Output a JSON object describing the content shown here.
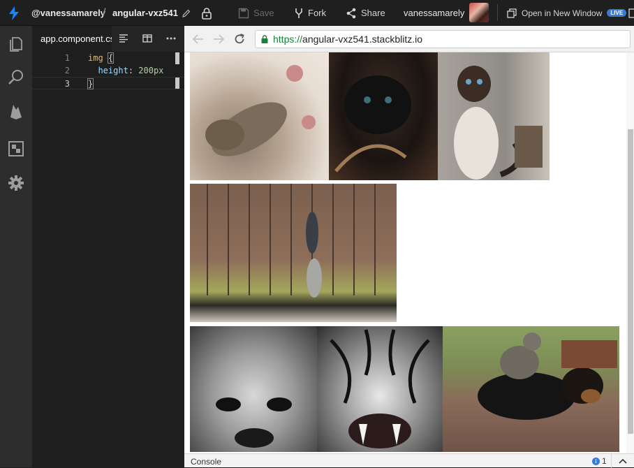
{
  "topbar": {
    "user": "@vanessamarely",
    "separator": "/",
    "project": "angular-vxz541",
    "save_label": "Save",
    "fork_label": "Fork",
    "share_label": "Share",
    "username": "vanessamarely",
    "open_window_label": "Open in New Window",
    "live_badge": "LIVE"
  },
  "activity_bar": {
    "icons": [
      "files-icon",
      "search-icon",
      "firebase-icon",
      "extensions-icon",
      "settings-icon"
    ]
  },
  "editor": {
    "tab_label": "app.component.css",
    "lines": [
      {
        "number": "1",
        "selector": "img",
        "brace": "{"
      },
      {
        "number": "2",
        "property": "height",
        "value": "200px"
      },
      {
        "number": "3",
        "brace": "}"
      }
    ]
  },
  "browser": {
    "url_scheme": "https://",
    "url_host": "angular-vxz541.stackblitz.io",
    "images": [
      "kitten-playing-image",
      "black-kitten-image",
      "siamese-cat-image",
      "cats-climbing-fence-image",
      "grayscale-kitten-image",
      "tiger-face-image",
      "cat-riding-dog-image"
    ]
  },
  "console": {
    "label": "Console",
    "count": "1"
  },
  "colors": {
    "accent": "#3a7bd5",
    "stackblitz_bolt": "#1389fd",
    "url_green": "#188038"
  }
}
